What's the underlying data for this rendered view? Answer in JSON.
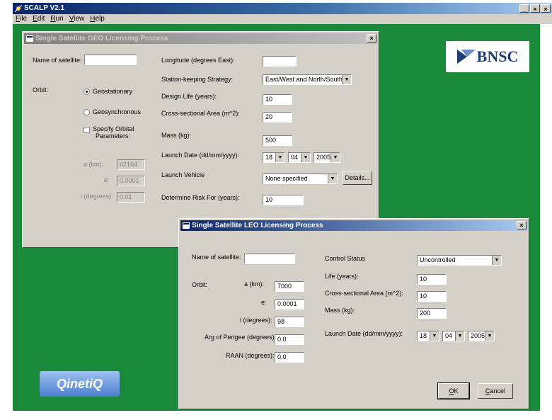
{
  "app": {
    "title": "SCALP V2.1",
    "menu": [
      "File",
      "Edit",
      "Run",
      "View",
      "Help"
    ],
    "controls": {
      "minimize": "_",
      "maximize": "×",
      "close": "×"
    }
  },
  "logos": {
    "bnsc": "BNSC",
    "qinetiq": "QinetiQ"
  },
  "geo": {
    "title": "Single Satellite GEO Licensing Process",
    "close": "×",
    "name_label": "Name of satellite:",
    "name_value": "",
    "orbit_label": "Orbit:",
    "radio_geostationary": "Geostationary",
    "radio_geosynchronous": "Geosynchronous",
    "chk_specify_line1": "Specify Orbital",
    "chk_specify_line2": "Parameters:",
    "a_label": "a (km):",
    "a_value": "42164",
    "e_label": "e:",
    "e_value": "0.0001",
    "i_label": "i (degrees):",
    "i_value": "0.01",
    "longitude_label": "Longitude (degrees East):",
    "longitude_value": "",
    "stationkeeping_label": "Station-keeping Strategy:",
    "stationkeeping_value": "East/West and North/South",
    "design_life_label": "Design Life (years):",
    "design_life_value": "10",
    "area_label": "Cross-sectional Area (m^2):",
    "area_value": "20",
    "mass_label": "Mass (kg):",
    "mass_value": "500",
    "launch_date_label": "Launch Date (dd/mm/yyyy):",
    "day": "18",
    "month": "04",
    "year": "2005",
    "launch_vehicle_label": "Launch Vehicle",
    "launch_vehicle_value": "None specified",
    "details_button": "Details...",
    "risk_label": "Determine Risk For (years):",
    "risk_value": "10"
  },
  "leo": {
    "title": "Single Satellite LEO Licensing Process",
    "close": "×",
    "name_label": "Name of satellite:",
    "name_value": "",
    "orbit_label": "Orbit:",
    "a_label": "a (km):",
    "a_value": "7000",
    "e_label": "e:",
    "e_value": "0.0001",
    "i_label": "i (degrees):",
    "i_value": "98",
    "perigee_label": "Arg of Perigee (degrees):",
    "perigee_value": "0.0",
    "raan_label": "RAAN (degrees):",
    "raan_value": "0.0",
    "control_label": "Control Status",
    "control_value": "Uncontrolled",
    "life_label": "Life (years):",
    "life_value": "10",
    "area_label": "Cross-sectional Area (m^2):",
    "area_value": "10",
    "mass_label": "Mass (kg):",
    "mass_value": "200",
    "launch_date_label": "Launch Date (dd/mm/yyyy):",
    "day": "18",
    "month": "04",
    "year": "2005",
    "ok_button": "OK",
    "cancel_button": "Cancel"
  },
  "colors": {
    "desktop": "#1a8a3a",
    "dialog": "#d4d0c8",
    "active_title": "#0a246a",
    "bnsc_text": "#1f3d7a"
  },
  "icons": [
    "app-icon",
    "dialog-icon",
    "dropdown-arrow-icon",
    "close-icon",
    "bnsc-logo-mark-icon"
  ]
}
